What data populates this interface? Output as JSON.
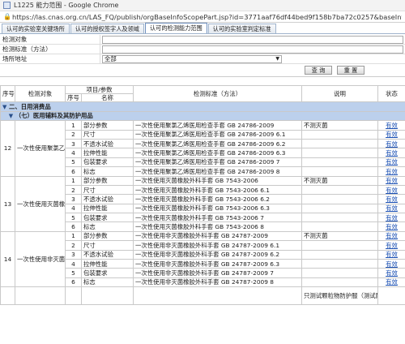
{
  "window": {
    "title": "L1225 能力范围 - Google Chrome"
  },
  "address": {
    "url": "https://las.cnas.org.cn/LAS_FQ/publish/orgBaseInfoScopePart.jsp?id=3771aaf76df44bed9f158b7ba72c0257&baseInfoId=..."
  },
  "tabs": [
    {
      "label": "认可的实验室关键场所"
    },
    {
      "label": "认可的授权签字人及领域"
    },
    {
      "label": "认可的检测能力范围"
    },
    {
      "label": "认可的实验室判定标准"
    }
  ],
  "search": {
    "object_label": "检测对象",
    "standard_label": "检测标准（方法）",
    "site_label": "场所地址",
    "site_value": "全部",
    "query_button": "查 询",
    "reset_button": "重 置"
  },
  "table": {
    "headers": {
      "seq": "序号",
      "object": "检测对象",
      "item_group": "项目/参数",
      "item_seq": "序号",
      "item_name": "名称",
      "standard": "检测标准（方法）",
      "note": "说明",
      "status": "状态"
    },
    "category1": "二、日用消费品",
    "category2": "（七）医用辅料及其防护用品",
    "groups": [
      {
        "seq": "12",
        "object": "一次性使用聚氯乙烯医用检查手套",
        "rows": [
          {
            "no": "1",
            "name": "部分参数",
            "standard": "一次性使用聚氯乙烯医用检查手套 GB 24786-2009",
            "note": "不测灭菌",
            "status": "有效"
          },
          {
            "no": "2",
            "name": "尺寸",
            "standard": "一次性使用聚氯乙烯医用检查手套 GB 24786-2009 6.1",
            "note": "",
            "status": "有效"
          },
          {
            "no": "3",
            "name": "不透水试验",
            "standard": "一次性使用聚氯乙烯医用检查手套 GB 24786-2009 6.2",
            "note": "",
            "status": "有效"
          },
          {
            "no": "4",
            "name": "拉伸性能",
            "standard": "一次性使用聚氯乙烯医用检查手套 GB 24786-2009 6.3",
            "note": "",
            "status": "有效"
          },
          {
            "no": "5",
            "name": "包装要求",
            "standard": "一次性使用聚氯乙烯医用检查手套 GB 24786-2009 7",
            "note": "",
            "status": "有效"
          },
          {
            "no": "6",
            "name": "标志",
            "standard": "一次性使用聚氯乙烯医用检查手套 GB 24786-2009 8",
            "note": "",
            "status": "有效"
          }
        ]
      },
      {
        "seq": "13",
        "object": "一次性使用灭菌橡胶外科手套",
        "rows": [
          {
            "no": "1",
            "name": "部分参数",
            "standard": "一次性使用灭菌橡胶外科手套 GB 7543-2006",
            "note": "不测灭菌",
            "status": "有效"
          },
          {
            "no": "2",
            "name": "尺寸",
            "standard": "一次性使用灭菌橡胶外科手套 GB 7543-2006 6.1",
            "note": "",
            "status": "有效"
          },
          {
            "no": "3",
            "name": "不透水试验",
            "standard": "一次性使用灭菌橡胶外科手套 GB 7543-2006 6.2",
            "note": "",
            "status": "有效"
          },
          {
            "no": "4",
            "name": "拉伸性能",
            "standard": "一次性使用灭菌橡胶外科手套 GB 7543-2006 6.3",
            "note": "",
            "status": "有效"
          },
          {
            "no": "5",
            "name": "包装要求",
            "standard": "一次性使用灭菌橡胶外科手套 GB 7543-2006 7",
            "note": "",
            "status": "有效"
          },
          {
            "no": "6",
            "name": "标志",
            "standard": "一次性使用灭菌橡胶外科手套 GB 7543-2006 8",
            "note": "",
            "status": "有效"
          }
        ]
      },
      {
        "seq": "14",
        "object": "一次性使用非灭菌橡胶外科手套",
        "rows": [
          {
            "no": "1",
            "name": "部分参数",
            "standard": "一次性使用非灭菌橡胶外科手套 GB 24787-2009",
            "note": "不测灭菌",
            "status": "有效"
          },
          {
            "no": "2",
            "name": "尺寸",
            "standard": "一次性使用非灭菌橡胶外科手套 GB 24787-2009 6.1",
            "note": "",
            "status": "有效"
          },
          {
            "no": "3",
            "name": "不透水试验",
            "standard": "一次性使用非灭菌橡胶外科手套 GB 24787-2009 6.2",
            "note": "",
            "status": "有效"
          },
          {
            "no": "4",
            "name": "拉伸性能",
            "standard": "一次性使用非灭菌橡胶外科手套 GB 24787-2009 6.3",
            "note": "",
            "status": "有效"
          },
          {
            "no": "5",
            "name": "包装要求",
            "standard": "一次性使用非灭菌橡胶外科手套 GB 24787-2009 7",
            "note": "",
            "status": "有效"
          },
          {
            "no": "6",
            "name": "标志",
            "standard": "一次性使用非灭菌橡胶外科手套 GB 24787-2009 8",
            "note": "",
            "status": "有效"
          }
        ]
      }
    ],
    "partial_note": "只测试颗粒物防护服（测试耐静水压性能、耐固体"
  }
}
